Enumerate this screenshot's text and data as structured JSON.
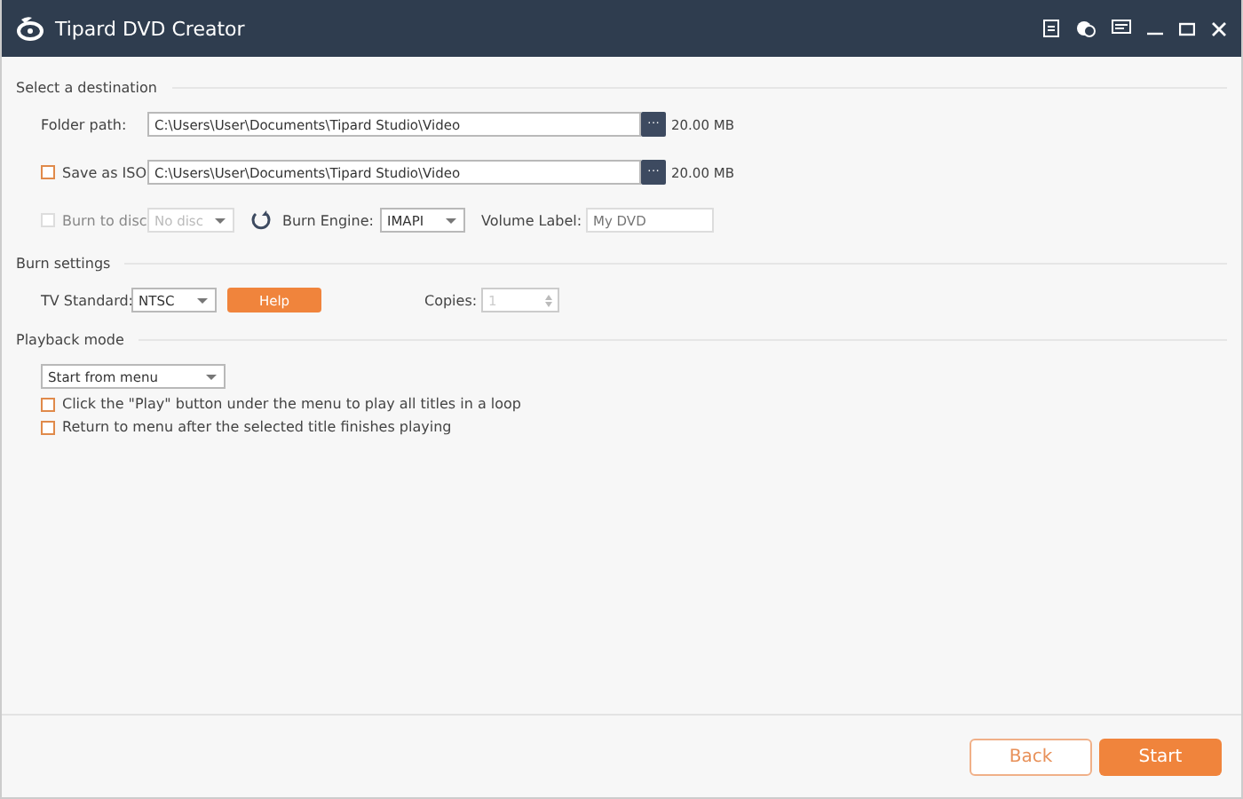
{
  "window": {
    "title": "Tipard DVD Creator"
  },
  "destination": {
    "heading": "Select a destination",
    "folder": {
      "label": "Folder path:",
      "value": "C:\\Users\\User\\Documents\\Tipard Studio\\Video",
      "browse": "···",
      "size": "20.00 MB"
    },
    "iso": {
      "label": "Save as ISO",
      "checked": false,
      "disabled": false,
      "value": "C:\\Users\\User\\Documents\\Tipard Studio\\Video",
      "browse": "···",
      "size": "20.00 MB"
    },
    "disc": {
      "label": "Burn to disc",
      "checked": false,
      "disabled": true,
      "disc_select": {
        "value": "No disc",
        "disabled": true
      },
      "engine_label": "Burn Engine:",
      "engine_select": {
        "value": "IMAPI",
        "disabled": false
      },
      "volume_label": "Volume Label:",
      "volume_field": {
        "placeholder": "My DVD"
      }
    }
  },
  "burn": {
    "heading": "Burn settings",
    "tv_label": "TV Standard:",
    "tv_select": {
      "value": "NTSC",
      "disabled": false
    },
    "help": "Help",
    "copies_label": "Copies:",
    "copies_field": {
      "value": "1",
      "disabled": true
    }
  },
  "playback": {
    "heading": "Playback mode",
    "mode_select": {
      "value": "Start from menu",
      "disabled": false
    },
    "options": [
      {
        "label": "Click the \"Play\" button under the menu to play all titles in a loop",
        "checked": false
      },
      {
        "label": "Return to menu after the selected title finishes playing",
        "checked": false
      }
    ]
  },
  "footer": {
    "back": "Back",
    "start": "Start"
  }
}
